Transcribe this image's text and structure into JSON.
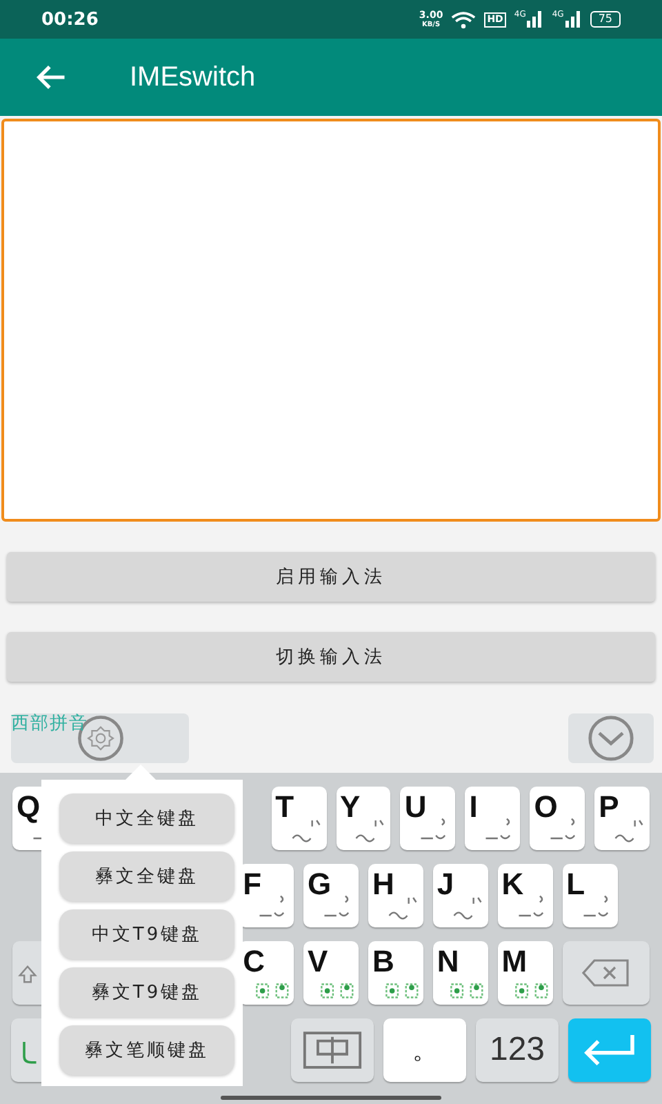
{
  "status_bar": {
    "time": "00:26",
    "speed_value": "3.00",
    "speed_unit": "KB/S",
    "hd_label": "HD",
    "network_labels": [
      "4G",
      "4G"
    ],
    "battery": "75"
  },
  "app_bar": {
    "title": "IMEswitch"
  },
  "text_area": {
    "focused": true
  },
  "buttons": [
    "启用输入法",
    "切换输入法"
  ],
  "candidate_bar": {
    "ime_name": "西部拼音"
  },
  "keyboard": {
    "rows": [
      {
        "keys": [
          {
            "label": "Q"
          },
          {
            "label": "T"
          },
          {
            "label": "Y"
          },
          {
            "label": "U"
          },
          {
            "label": "I"
          },
          {
            "label": "O"
          },
          {
            "label": "P"
          }
        ]
      },
      {
        "keys": [
          {
            "label": "F"
          },
          {
            "label": "G"
          },
          {
            "label": "H"
          },
          {
            "label": "J"
          },
          {
            "label": "K"
          },
          {
            "label": "L"
          }
        ]
      },
      {
        "keys": [
          {
            "label": "C"
          },
          {
            "label": "V"
          },
          {
            "label": "B"
          },
          {
            "label": "N"
          },
          {
            "label": "M"
          }
        ]
      }
    ],
    "bottom_row": {
      "period": "。",
      "numbers": "123"
    }
  },
  "popup_menu": {
    "items": [
      {
        "label": "中文全键盘"
      },
      {
        "label": "彝文全键盘"
      },
      {
        "label": "中文T9键盘"
      },
      {
        "label": "彝文T9键盘"
      },
      {
        "label": "彝文笔顺键盘"
      }
    ]
  }
}
